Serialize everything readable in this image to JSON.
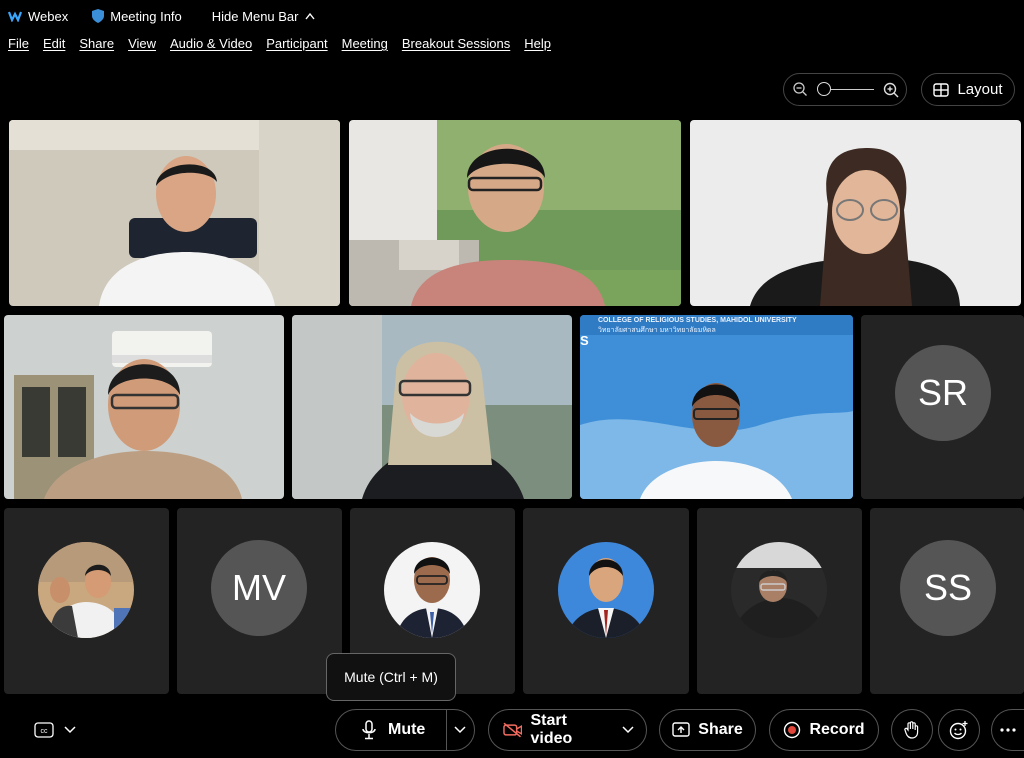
{
  "titlebar": {
    "app_name": "Webex",
    "meeting_info": "Meeting Info",
    "hide_menu": "Hide Menu Bar"
  },
  "menubar": [
    "File",
    "Edit",
    "Share",
    "View",
    "Audio & Video",
    "Participant",
    "Meeting",
    "Breakout Sessions",
    "Help"
  ],
  "layout_button": "Layout",
  "participants": {
    "initials_sr": "SR",
    "initials_mv": "MV",
    "initials_ss": "SS"
  },
  "shared_screen_text": "COLLEGE OF RELIGIOUS STUDIES, MAHIDOL UNIVERSITY",
  "shared_screen_thai": "วิทยาลัยศาสนศึกษา มหาวิทยาลัยมหิดล",
  "tooltip": "Mute (Ctrl + M)",
  "toolbar": {
    "mute": "Mute",
    "start_video": "Start video",
    "share": "Share",
    "record": "Record"
  },
  "colors": {
    "background": "#000000",
    "tile": "#232323",
    "initials_avatar": "#555555",
    "record_red": "#e0463a",
    "video_off_red": "#f06b60"
  }
}
